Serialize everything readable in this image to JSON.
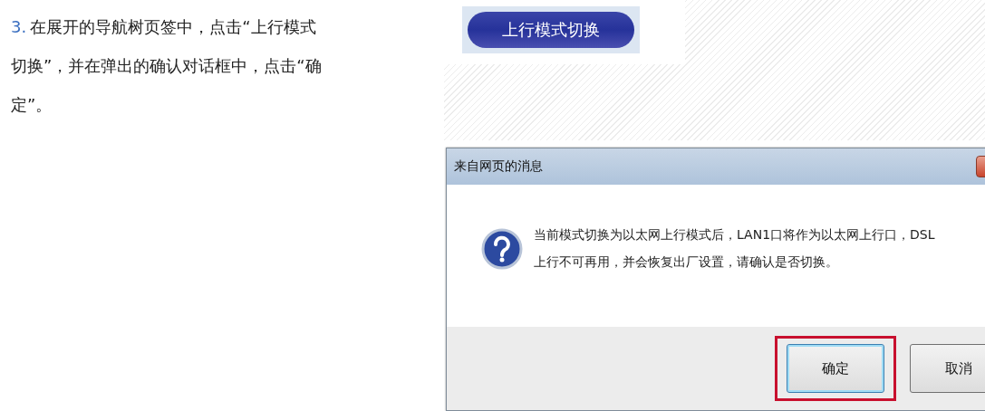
{
  "step": {
    "number": "3.",
    "lines": [
      "在展开的导航树页签中，点击“上行模式",
      "切换”，并在弹出的确认对话框中，点击“确",
      "定”。"
    ]
  },
  "mode_button": {
    "label": "上行模式切换"
  },
  "dialog": {
    "title": "来自网页的消息",
    "message_lines": [
      "当前模式切换为以太网上行模式后，LAN1口将作为以太网上行口，DSL",
      "上行不可再用，并会恢复出厂设置，请确认是否切换。"
    ],
    "buttons": [
      {
        "label": "确定",
        "highlighted": true
      },
      {
        "label": "取消",
        "highlighted": false
      }
    ]
  }
}
